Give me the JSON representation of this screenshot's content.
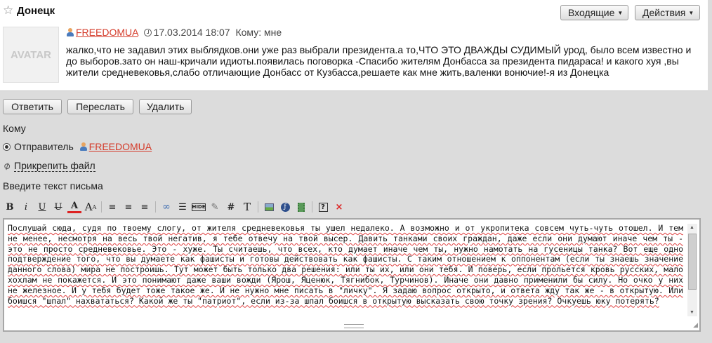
{
  "header": {
    "subject": "Донецк",
    "inbox_button": "Входящие",
    "actions_button": "Действия"
  },
  "message": {
    "avatar_text": "AVATAR",
    "author": "FREEDOMUA",
    "date": "17.03.2014 18:07",
    "recipient": "Кому: мне",
    "body": "жалко,что не задавил этих выблядков.они уже раз выбрали президента.а то,ЧТО ЭТО ДВАЖДЫ СУДИМЫЙ урод, было всем известно и до выборов.зато он наш-кричали идиоты.появилась поговорка -Спасибо жителям Донбасса за президента пидараса! и какого хуя ,вы жители средневековья,слабо отличающие Донбасс от Кузбасса,решаете как мне жить,валенки вонючие!-я из Донецка"
  },
  "actions": {
    "reply": "Ответить",
    "forward": "Переслать",
    "delete": "Удалить"
  },
  "reply_form": {
    "to_label": "Кому",
    "sender_option": "Отправитель",
    "sender_name": "FREEDOMUA",
    "attach_label": "Прикрепить файл",
    "text_label": "Введите текст письма",
    "toolbar": [
      "bold-icon",
      "italic-icon",
      "underline-icon",
      "strikethrough-icon",
      "font-color-icon",
      "font-size-icon",
      "align-left-icon",
      "align-center-icon",
      "align-right-icon",
      "link-icon",
      "list-icon",
      "hide-icon",
      "edit-icon",
      "hash-icon",
      "text-icon",
      "image-icon",
      "flash-icon",
      "video-icon",
      "help-icon",
      "remove-format-icon"
    ],
    "body": "Послушай сюда, судя по твоему слогу, от жителя средневековья ты ушел недалеко. А возможно и от укропитека совсем чуть-чуть отошел. И тем не менее, несмотря на весь твой негатив, я тебе отвечу на твой высер. Давить танками своих граждан, даже если они думают иначе чем ты - это не просто средневековье. Это - хуже. Ты считаешь, что всех, кто думает иначе чем ты, нужно намотать на гусеницы танка? Вот еще одно подтверждение того, что вы думаете как фашисты и готовы действовать как фашисты. С таким отношением к оппонентам (если ты знаешь значение данного слова) мира не построишь. Тут может быть только два решения: или ты их, или они тебя. И поверь, если прольется кровь русских, мало хохлам не покажется. И это понимают даже ваши вожди (Ярош, Яценюк, Тягнибок, Турчинов). Иначе они давно применили бы силу. Но очко у них не железное. И у тебя будет тоже такое же. И не нужно мне писать в \"личку\". Я задаю вопрос открыто, и ответа жду так же - в открытую. Или боишся \"шпал\" нахвататься? Какой же ты \"патриот\", если из-за шпал боишся в открытую высказать свою точку зрения? Очкуешь юку потерять?"
  }
}
